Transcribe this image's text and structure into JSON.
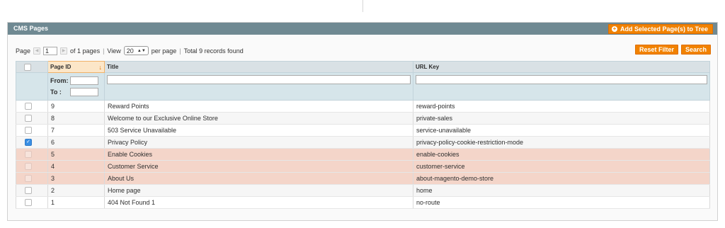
{
  "panel": {
    "title": "CMS Pages",
    "add_button_label": "Add Selected Page(s) to Tree"
  },
  "pager": {
    "page_label": "Page",
    "page_value": "1",
    "of_pages": "of 1 pages",
    "view_label": "View",
    "view_value": "20",
    "per_page": "per page",
    "total": "Total 9 records found",
    "separator": "|"
  },
  "buttons": {
    "reset": "Reset Filter",
    "search": "Search"
  },
  "columns": {
    "page_id": "Page ID",
    "title": "Title",
    "url_key": "URL Key"
  },
  "filter": {
    "from_label": "From:",
    "to_label": "To :"
  },
  "rows": [
    {
      "id": "9",
      "title": "Reward Points",
      "url": "reward-points",
      "checked": false,
      "highlight": false
    },
    {
      "id": "8",
      "title": "Welcome to our Exclusive Online Store",
      "url": "private-sales",
      "checked": false,
      "highlight": false
    },
    {
      "id": "7",
      "title": "503 Service Unavailable",
      "url": "service-unavailable",
      "checked": false,
      "highlight": false
    },
    {
      "id": "6",
      "title": "Privacy Policy",
      "url": "privacy-policy-cookie-restriction-mode",
      "checked": true,
      "highlight": false
    },
    {
      "id": "5",
      "title": "Enable Cookies",
      "url": "enable-cookies",
      "checked": false,
      "highlight": true
    },
    {
      "id": "4",
      "title": "Customer Service",
      "url": "customer-service",
      "checked": false,
      "highlight": true
    },
    {
      "id": "3",
      "title": "About Us",
      "url": "about-magento-demo-store",
      "checked": false,
      "highlight": true
    },
    {
      "id": "2",
      "title": "Home page",
      "url": "home",
      "checked": false,
      "highlight": false
    },
    {
      "id": "1",
      "title": "404 Not Found 1",
      "url": "no-route",
      "checked": false,
      "highlight": false
    }
  ],
  "colors": {
    "header": "#6f8992",
    "accent": "#f18200",
    "highlight_row": "#f4d5c9",
    "check_blue": "#3a8fe4"
  },
  "icons": {
    "add": "plus-circle-icon",
    "sort": "arrow-down-icon",
    "prev": "arrow-left-icon",
    "next": "arrow-right-icon",
    "stepper": "updown-icon"
  }
}
